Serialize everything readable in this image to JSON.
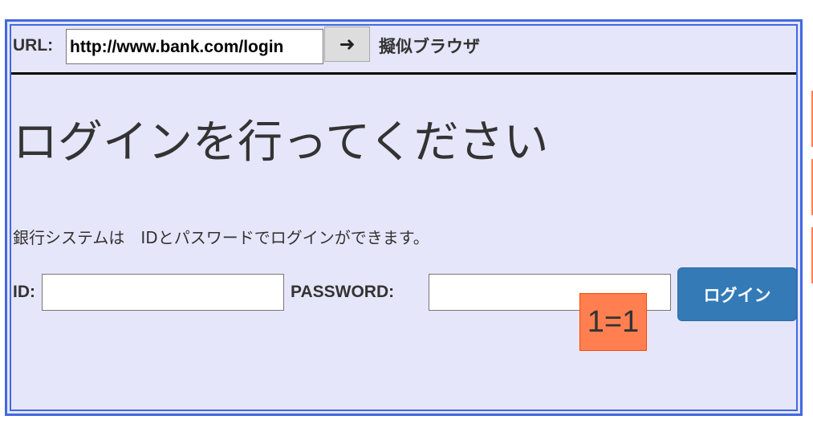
{
  "browser": {
    "url_label": "URL:",
    "url_value": "http://www.bank.com/login",
    "go_icon": "➜",
    "name": "擬似ブラウザ"
  },
  "page": {
    "heading": "ログインを行ってください",
    "description": "銀行システムは　IDとパスワードでログインができます。",
    "id_label": "ID:",
    "id_value": "",
    "password_label": "PASSWORD:",
    "password_value": "",
    "login_button": "ログイン"
  },
  "overlay": {
    "injection_text": "1=1"
  },
  "colors": {
    "frame": "#4169e1",
    "background": "#e6e6fa",
    "button": "#337ab7",
    "tag": "#ff7f50"
  }
}
